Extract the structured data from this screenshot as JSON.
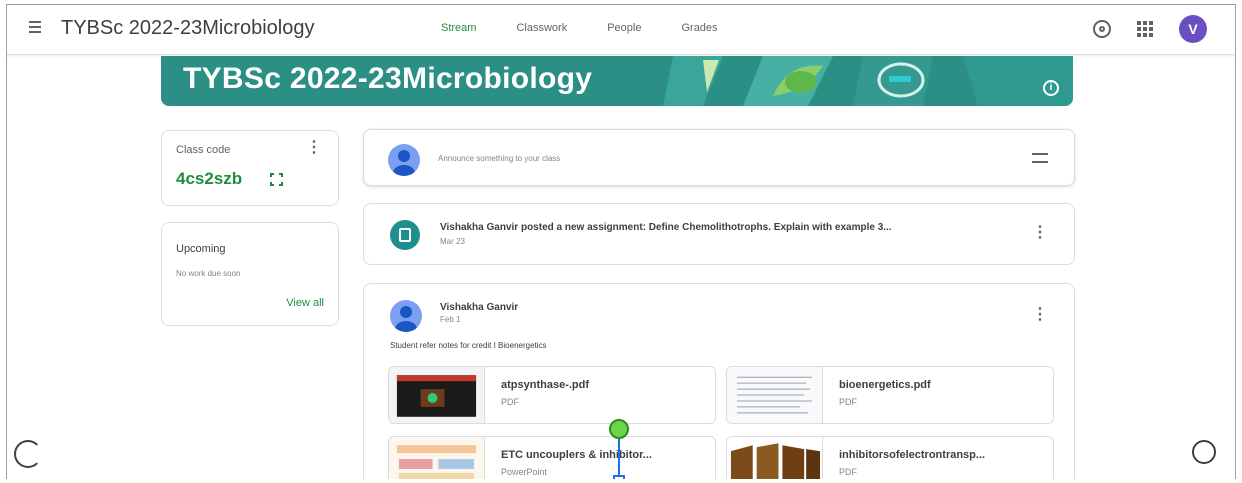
{
  "header": {
    "title": "TYBSc 2022-23Microbiology",
    "tabs": [
      {
        "label": "Stream",
        "active": true
      },
      {
        "label": "Classwork",
        "active": false
      },
      {
        "label": "People",
        "active": false
      },
      {
        "label": "Grades",
        "active": false
      }
    ],
    "avatar_letter": "V",
    "icons": [
      "menu-icon",
      "gear-icon",
      "apps-grid-icon"
    ]
  },
  "banner": {
    "title": "TYBSc 2022-23Microbiology",
    "color": "#2b8f86"
  },
  "class_code": {
    "label": "Class code",
    "value": "4cs2szb"
  },
  "upcoming": {
    "label": "Upcoming",
    "text": "No work due soon",
    "link": "View all"
  },
  "announce": {
    "placeholder": "Announce something to your class"
  },
  "assignment": {
    "title": "Vishakha Ganvir posted a new assignment: Define Chemolithotrophs. Explain with example 3...",
    "date": "Mar 23"
  },
  "post": {
    "author": "Vishakha Ganvir",
    "date": "Feb 1",
    "text": "Student refer notes for credit I Bioenergetics",
    "attachments": [
      {
        "name": "atpsynthase-.pdf",
        "type": "PDF"
      },
      {
        "name": "bioenergetics.pdf",
        "type": "PDF"
      },
      {
        "name": "ETC uncouplers & inhibitor...",
        "type": "PowerPoint"
      },
      {
        "name": "inhibitorsofelectrontransp...",
        "type": "PDF"
      }
    ]
  },
  "colors": {
    "accent": "#1e8e3e",
    "avatar": "#6a4fc3",
    "banner": "#2b8f86"
  }
}
